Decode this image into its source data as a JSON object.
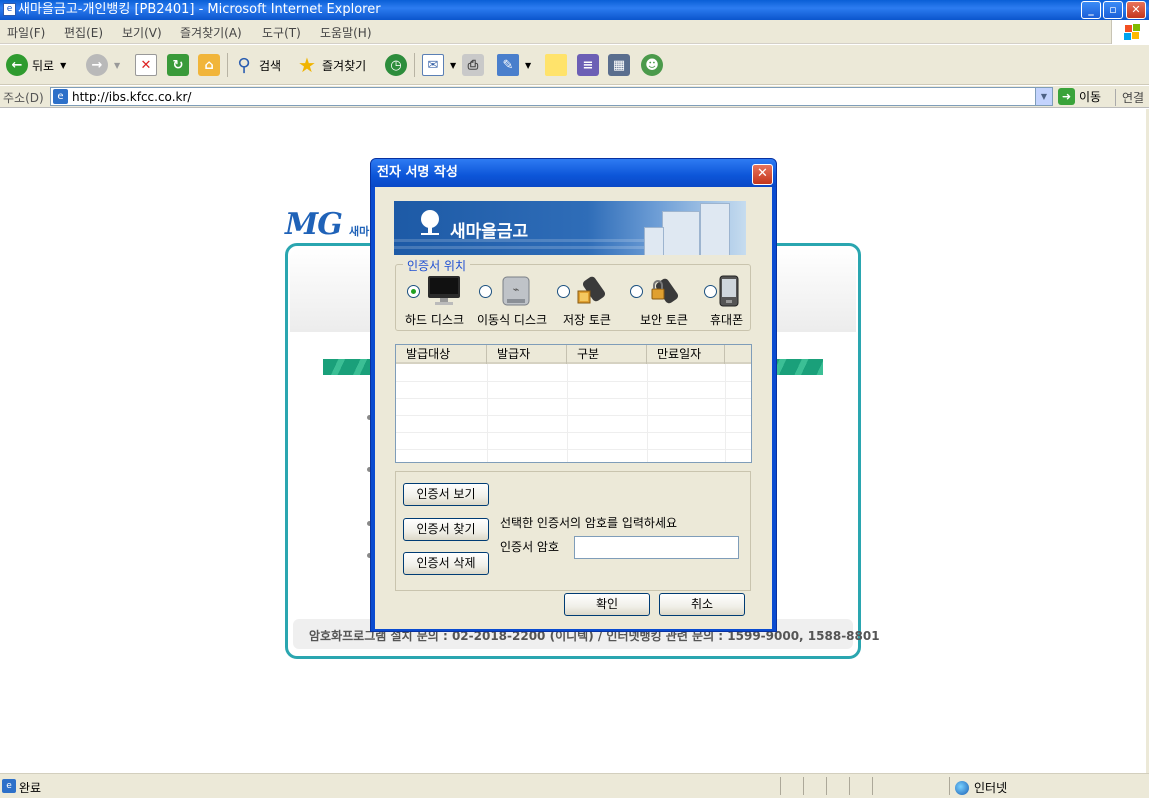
{
  "window": {
    "title": "새마을금고-개인뱅킹 [PB2401] - Microsoft Internet Explorer",
    "btn_min": "_",
    "btn_max": "▫",
    "btn_close": "✕"
  },
  "menu": [
    "파일(F)",
    "편집(E)",
    "보기(V)",
    "즐겨찾기(A)",
    "도구(T)",
    "도움말(H)"
  ],
  "toolbar": {
    "back": "뒤로",
    "search": "검색",
    "favorites": "즐겨찾기"
  },
  "address": {
    "label": "주소(D)",
    "url": "http://ibs.kfcc.co.kr/",
    "go": "이동",
    "links": "연결"
  },
  "page": {
    "logo": "MG",
    "logo_sub": "새마",
    "footer": "암호화프로그램 설치 문의 : 02-2018-2200 (이니텍)   /   인터넷뱅킹 관련 문의 : 1599-9000, 1588-8801"
  },
  "dialog": {
    "title": "전자 서명 작성",
    "close": "✕",
    "banner_text": "새마을금고",
    "location_legend": "인증서 위치",
    "locations": [
      {
        "label": "하드 디스크",
        "icon": "monitor-icon",
        "selected": true
      },
      {
        "label": "이동식 디스크",
        "icon": "usb-drive-icon",
        "selected": false
      },
      {
        "label": "저장 토큰",
        "icon": "storage-token-icon",
        "selected": false
      },
      {
        "label": "보안 토큰",
        "icon": "security-token-icon",
        "selected": false
      },
      {
        "label": "휴대폰",
        "icon": "mobile-phone-icon",
        "selected": false
      }
    ],
    "table_headers": [
      "발급대상",
      "발급자",
      "구분",
      "만료일자"
    ],
    "btn_view": "인증서  보기",
    "btn_find": "인증서  찾기",
    "btn_delete": "인증서 삭제",
    "password_message": "선택한 인증서의 암호를 입력하세요",
    "password_label": "인증서 암호",
    "password_value": "",
    "btn_ok": "확인",
    "btn_cancel": "취소"
  },
  "status": {
    "text": "완료",
    "zone": "인터넷"
  }
}
